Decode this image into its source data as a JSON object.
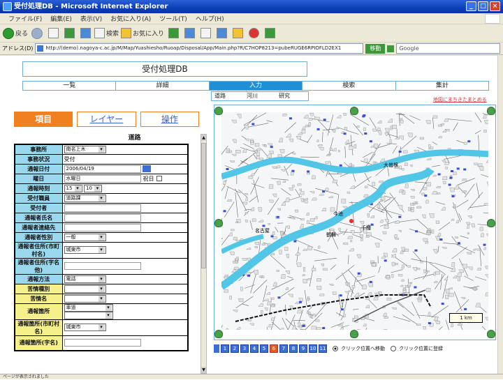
{
  "window": {
    "title": "受付処理DB - Microsoft Internet Explorer",
    "menu": [
      "ファイル(F)",
      "編集(E)",
      "表示(V)",
      "お気に入り(A)",
      "ツール(T)",
      "ヘルプ(H)"
    ],
    "toolbar": {
      "back": "戻る",
      "search": "検索",
      "favorites": "お気に入り"
    },
    "address": "http://(demo).nagoya-c.ac.jp/M/Map/Yuashiesho/Ruoap/Disposal/App/Main.php?R/C7HOP8213=pubeRUGE6RPIOFLD2EX1",
    "address_label": "アドレス(D)",
    "go": "移動",
    "google": "Google"
  },
  "app": {
    "title": "受付処理DB",
    "nav": [
      "一覧",
      "詳細",
      "入力",
      "検索",
      "集計"
    ],
    "subtabs": [
      "道路",
      "河川",
      "研究"
    ],
    "help_link": "地図にまちきたまとめる"
  },
  "left_tabs": [
    "項目",
    "レイヤー",
    "操作"
  ],
  "form": {
    "header": "道路",
    "rows": [
      {
        "label": "事務所",
        "type": "select",
        "value": "南名上木"
      },
      {
        "label": "事務状況",
        "type": "text",
        "value": "受付"
      },
      {
        "label": "通報日付",
        "type": "date",
        "value": "2006/04/19"
      },
      {
        "label": "曜日",
        "type": "weekday",
        "value": "水曜日",
        "extra": "祝日"
      },
      {
        "label": "通報時刻",
        "type": "time",
        "value": "15",
        "value2": "10"
      },
      {
        "label": "受付職員",
        "type": "select",
        "value": "道路課"
      },
      {
        "label": "受付者",
        "type": "input",
        "value": ""
      },
      {
        "label": "通報者氏名",
        "type": "input",
        "value": ""
      },
      {
        "label": "通報者連絡先",
        "type": "input",
        "value": ""
      },
      {
        "label": "通報者性別",
        "type": "select",
        "value": "一般"
      },
      {
        "label": "通報者住所(市町村名)",
        "type": "select",
        "value": "城東市"
      },
      {
        "label": "通報者住所(字名 他)",
        "type": "input",
        "value": ""
      },
      {
        "label": "通報方法",
        "type": "select",
        "value": "電話"
      },
      {
        "label": "苦情種別",
        "type": "select",
        "value": ""
      },
      {
        "label": "苦情名",
        "type": "select",
        "value": ""
      },
      {
        "label": "通報箇所",
        "type": "select2",
        "value": "車道",
        "value2": ""
      },
      {
        "label": "通報箇所(市町村名)",
        "type": "select",
        "value": "城東市"
      },
      {
        "label": "通報箇所(字名)",
        "type": "input",
        "value": ""
      }
    ]
  },
  "map": {
    "scale_label": "1 km",
    "zoom_levels": [
      "1",
      "2",
      "3",
      "4",
      "5",
      "6",
      "7",
      "8",
      "9",
      "10",
      "11"
    ],
    "zoom_selected": 5,
    "click_options": [
      "クリック位置へ移動",
      "クリック位置に登録"
    ],
    "click_selected": 0,
    "place_labels": [
      "大曽根",
      "今池",
      "千種",
      "鶴舞",
      "名古屋"
    ]
  },
  "status": "ページが表示されました",
  "colors": {
    "accent": "#1f8fd6",
    "tab_orange": "#f08020",
    "label_blue": "#9ad8ee",
    "label_yellow": "#f5f08a",
    "river": "#52c6e6"
  }
}
